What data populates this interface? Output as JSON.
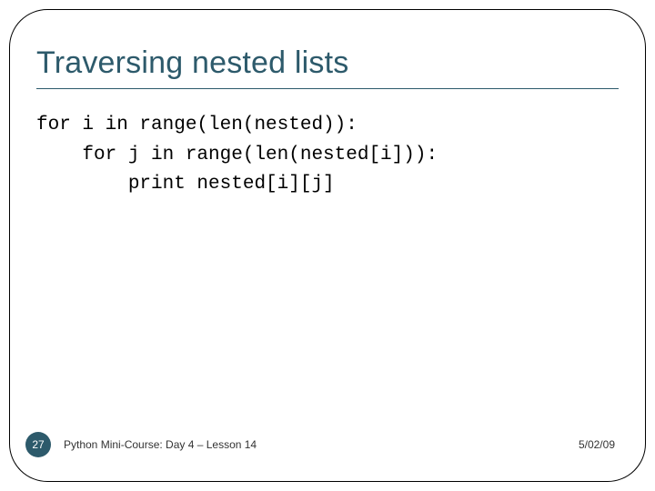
{
  "title": "Traversing nested lists",
  "code": {
    "line1": "for i in range(len(nested)):",
    "line2": "    for j in range(len(nested[i])):",
    "line3": "        print nested[i][j]"
  },
  "footer": {
    "page": "27",
    "course": "Python Mini-Course: Day 4 – Lesson 14",
    "date": "5/02/09"
  },
  "colors": {
    "accent": "#2d5a6b"
  }
}
